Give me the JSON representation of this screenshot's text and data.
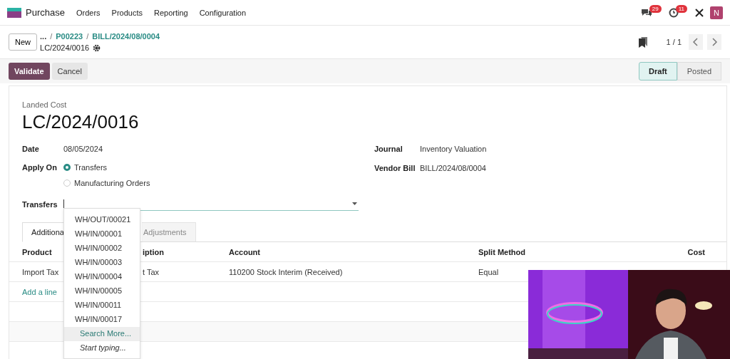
{
  "navbar": {
    "app": "Purchase",
    "menus": [
      "Orders",
      "Products",
      "Reporting",
      "Configuration"
    ],
    "messages_badge": "29",
    "activities_badge": "11",
    "avatar": "N"
  },
  "control_panel": {
    "new_button": "New",
    "breadcrumbs": [
      "...",
      "P00223",
      "BILL/2024/08/0004"
    ],
    "separator": "/",
    "record": "LC/2024/0016",
    "pager": "1 / 1"
  },
  "actions": [
    "Validate",
    "Cancel"
  ],
  "statusbar": [
    {
      "label": "Draft",
      "selected": true
    },
    {
      "label": "Posted",
      "selected": false
    }
  ],
  "form": {
    "caption": "Landed Cost",
    "name": "LC/2024/0016",
    "left_fields": [
      {
        "label": "Date",
        "value": "08/05/2024"
      }
    ],
    "apply_on": {
      "label": "Apply On",
      "options": [
        {
          "label": "Transfers",
          "selected": true
        },
        {
          "label": "Manufacturing Orders",
          "selected": false
        }
      ]
    },
    "right_fields": [
      {
        "label": "Journal",
        "value": "Inventory Valuation"
      },
      {
        "label": "Vendor Bill",
        "value": "BILL/2024/08/0004"
      }
    ],
    "transfers": {
      "label": "Transfers"
    }
  },
  "dropdown": {
    "items": [
      "WH/OUT/00021",
      "WH/IN/00001",
      "WH/IN/00002",
      "WH/IN/00003",
      "WH/IN/00004",
      "WH/IN/00005",
      "WH/IN/00011",
      "WH/IN/00017"
    ],
    "search_more": "Search More...",
    "hint": "Start typing..."
  },
  "tabs": [
    {
      "label": "Additiona",
      "selected": true
    },
    {
      "label": "Adjustments",
      "selected": false
    }
  ],
  "table": {
    "columns": [
      "Product",
      "iption",
      "Account",
      "Split Method",
      "Cost"
    ],
    "rows": [
      [
        "Import Tax",
        "t Tax",
        "110200 Stock Interim (Received)",
        "Equal"
      ]
    ],
    "add_line": "Add a line"
  },
  "video": {
    "kind": "picture"
  }
}
